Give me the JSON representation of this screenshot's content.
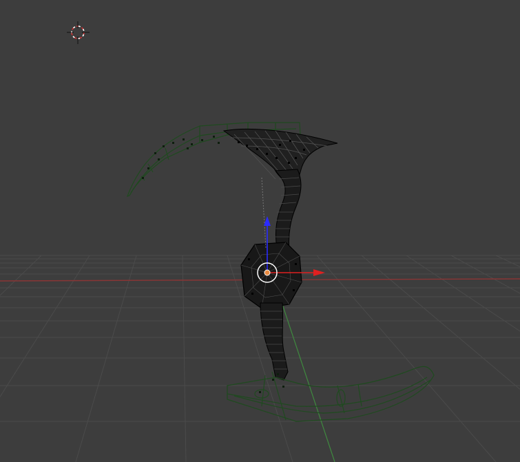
{
  "viewport": {
    "background": "#3d3d3d",
    "grid_color": "#4a4a4a",
    "x_axis_color": "#8a3a3a",
    "y_axis_color": "#3f7f3f"
  },
  "colors": {
    "selected_wire": "#000000",
    "unselected_wire": "#1f4a1f",
    "manipulator_z": "#2b2bff",
    "manipulator_x": "#e02020",
    "origin_ring": "#ffffff",
    "cursor_red": "#d03030",
    "cursor_dark": "#111111"
  },
  "icons": {
    "cursor": "3d-cursor-icon",
    "origin": "object-origin-icon"
  }
}
